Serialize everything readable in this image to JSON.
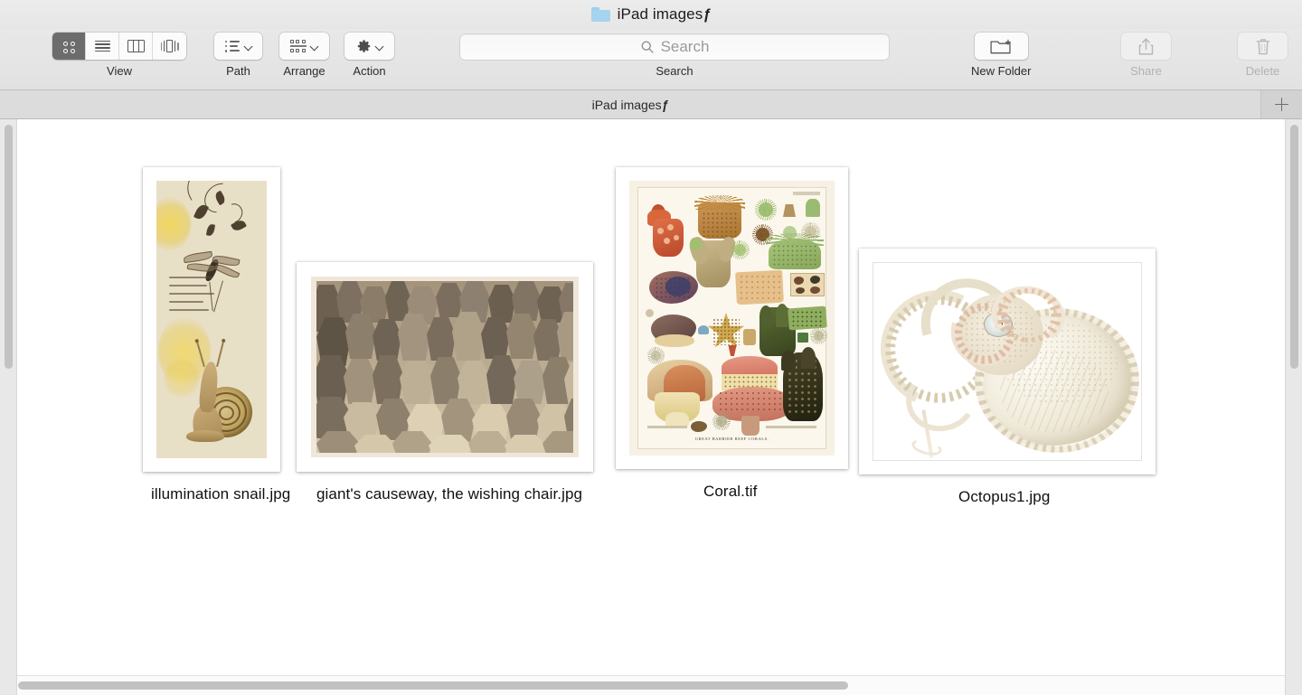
{
  "window": {
    "title_text": "iPad images",
    "title_suffix": "ƒ",
    "folder_icon": "folder-icon"
  },
  "toolbar": {
    "view": {
      "label": "View",
      "segments": [
        {
          "name": "icon-view",
          "icon": "grid-icon",
          "selected": true
        },
        {
          "name": "list-view",
          "icon": "list-icon",
          "selected": false
        },
        {
          "name": "column-view",
          "icon": "columns-icon",
          "selected": false
        },
        {
          "name": "gallery-view",
          "icon": "gallery-icon",
          "selected": false
        }
      ]
    },
    "path": {
      "label": "Path",
      "icon": "path-list-icon",
      "chevron": "chevron-down-icon"
    },
    "arrange": {
      "label": "Arrange",
      "icon": "arrange-grid-icon",
      "chevron": "chevron-down-icon"
    },
    "action": {
      "label": "Action",
      "icon": "gear-icon",
      "chevron": "chevron-down-icon"
    },
    "search": {
      "label": "Search",
      "placeholder": "Search",
      "value": "",
      "icon": "search-icon"
    },
    "new_folder": {
      "label": "New Folder",
      "icon": "new-folder-icon",
      "enabled": true
    },
    "share": {
      "label": "Share",
      "icon": "share-icon",
      "enabled": false
    },
    "delete": {
      "label": "Delete",
      "icon": "trash-icon",
      "enabled": false
    }
  },
  "tabbar": {
    "tabs": [
      {
        "label_text": "iPad images",
        "label_suffix": "ƒ",
        "active": true
      }
    ],
    "new_tab": {
      "icon": "plus-icon",
      "label": "+"
    }
  },
  "files": [
    {
      "name": "illumination snail.jpg",
      "kind": "image",
      "artwork": "illuminated-manuscript-snail",
      "orientation": "portrait"
    },
    {
      "name": "giant's causeway, the wishing chair.jpg",
      "kind": "image",
      "artwork": "sepia-basalt-columns-photograph",
      "orientation": "landscape"
    },
    {
      "name": "Coral.tif",
      "kind": "image",
      "artwork": "great-barrier-reef-corals-plate",
      "caption": "GREAT BARRIER REEF CORALS.",
      "orientation": "portrait"
    },
    {
      "name": "Octopus1.jpg",
      "kind": "image",
      "artwork": "octopus-scientific-illustration",
      "orientation": "landscape"
    }
  ],
  "scrollbars": {
    "vertical_left": {
      "name": "vertical-scrollbar-left"
    },
    "vertical_right": {
      "name": "vertical-scrollbar-right"
    },
    "horizontal": {
      "name": "horizontal-scrollbar"
    }
  },
  "colors": {
    "toolbar_bg": "#e6e6e6",
    "tabbar_bg": "#dcdcdc",
    "canvas_bg": "#ffffff",
    "selected_segment": "#6c6c6c",
    "folder_blue": "#a5d3f0",
    "disabled_text": "#b2b2b2",
    "scrollbar_thumb": "#c2c2c2"
  }
}
